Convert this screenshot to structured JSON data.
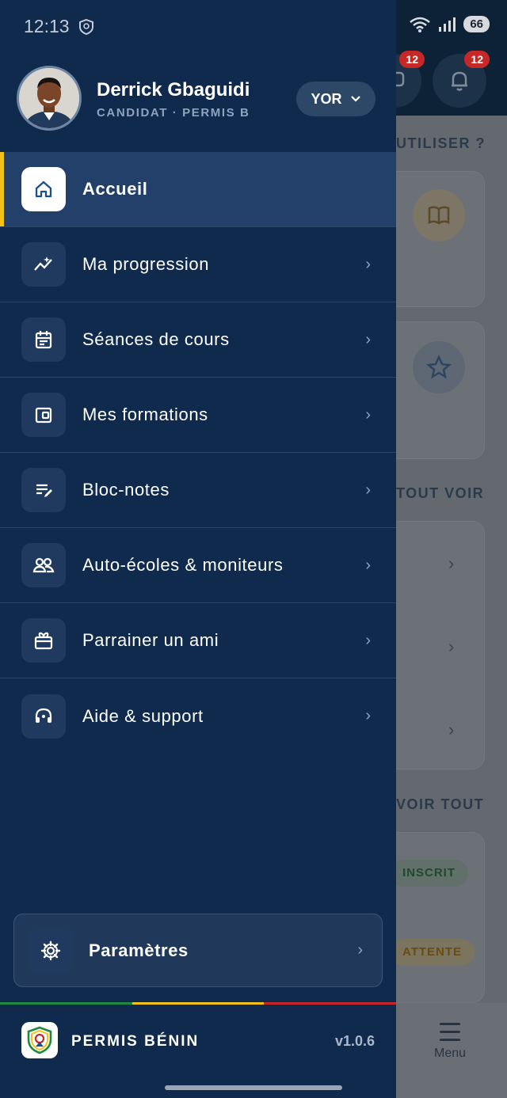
{
  "status_bar": {
    "time": "12:13",
    "battery": "66"
  },
  "background_app": {
    "notifications": {
      "messages_count": "12",
      "alerts_count": "12"
    },
    "sections": [
      "UTILISER ?",
      "TOUT VOIR",
      "VOIR TOUT"
    ],
    "pills": [
      "INSCRIT",
      "ATTENTE"
    ],
    "tab_label": "Menu"
  },
  "profile": {
    "name": "Derrick Gbaguidi",
    "role": "CANDIDAT · PERMIS B",
    "language": "YOR"
  },
  "nav": {
    "items": [
      {
        "label": "Accueil",
        "icon": "home-icon",
        "active": true
      },
      {
        "label": "Ma progression",
        "icon": "progress-chart-icon",
        "active": false
      },
      {
        "label": "Séances de cours",
        "icon": "calendar-icon",
        "active": false
      },
      {
        "label": "Mes formations",
        "icon": "wallet-icon",
        "active": false
      },
      {
        "label": "Bloc-notes",
        "icon": "notes-icon",
        "active": false
      },
      {
        "label": "Auto-écoles & moniteurs",
        "icon": "users-icon",
        "active": false
      },
      {
        "label": "Parrainer un ami",
        "icon": "gift-icon",
        "active": false
      },
      {
        "label": "Aide & support",
        "icon": "headset-icon",
        "active": false
      }
    ]
  },
  "settings": {
    "label": "Paramètres",
    "icon": "gear-icon"
  },
  "footer": {
    "brand": "PERMIS BÉNIN",
    "version": "v1.0.6"
  },
  "colors": {
    "drawer_bg": "#0f2a4d",
    "active_bg": "#22406a",
    "accent": "#f2c21a",
    "flag_green": "#1f8a3e",
    "flag_yellow": "#f2c21a",
    "flag_red": "#c62828"
  }
}
